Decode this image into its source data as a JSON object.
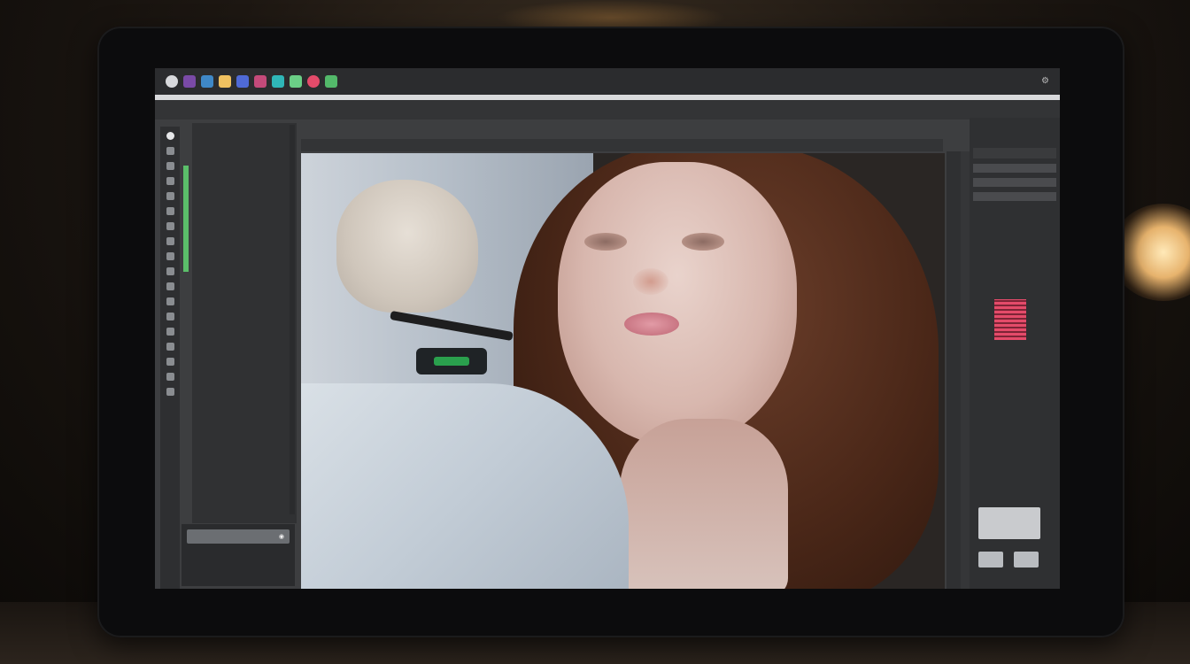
{
  "app": {
    "menu_items": [
      "",
      "",
      "",
      "",
      "",
      "",
      "",
      ""
    ],
    "accent_colors": {
      "record": "#e44b6a",
      "green": "#5bbf6a"
    }
  },
  "option_bar": {
    "items": [
      "",
      "",
      "",
      "",
      ""
    ]
  },
  "layers_panel": {
    "rows": []
  },
  "bottom_panel": {
    "field_label": "",
    "row1": "",
    "row2": ""
  },
  "document_bar": {
    "title": ""
  },
  "right_panel": {
    "tabs": [
      "",
      "",
      ""
    ],
    "section_title": ""
  },
  "canvas": {
    "subject": "photo-canvas"
  },
  "icons": [
    "app-icon",
    "brush-icon",
    "layers-icon",
    "record-icon",
    "settings-icon"
  ]
}
